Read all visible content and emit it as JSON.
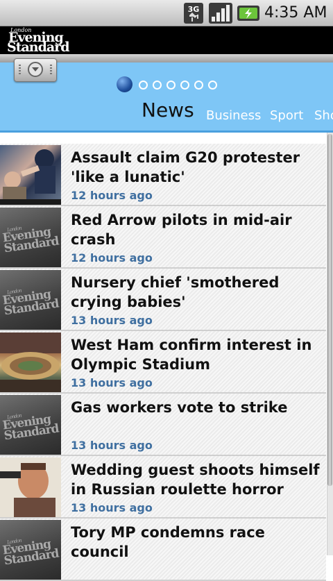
{
  "status_bar": {
    "network": "3G",
    "time": "4:35 AM",
    "icons": [
      "3g-data-icon",
      "signal-icon",
      "battery-charging-icon"
    ]
  },
  "brand": {
    "line1": "London",
    "line2": "Evening",
    "line3": "Standard"
  },
  "menu_button": {
    "icon": "chevron-down-icon"
  },
  "pager": {
    "count": 7,
    "active_index": 0
  },
  "tabs": {
    "active": "News",
    "others": [
      "Business",
      "Sport",
      "Sho"
    ]
  },
  "articles": [
    {
      "headline": "Assault claim G20 protester 'like a lunatic'",
      "time": "12 hours ago",
      "thumb": "photo-protest"
    },
    {
      "headline": "Red Arrow pilots in mid-air crash",
      "time": "12 hours ago",
      "thumb": "evening-standard-logo"
    },
    {
      "headline": "Nursery chief 'smothered crying babies'",
      "time": "13 hours ago",
      "thumb": "evening-standard-logo"
    },
    {
      "headline": "West Ham confirm interest in Olympic Stadium",
      "time": "13 hours ago",
      "thumb": "photo-stadium"
    },
    {
      "headline": "Gas workers vote to strike",
      "time": "13 hours ago",
      "thumb": "evening-standard-logo"
    },
    {
      "headline": "Wedding guest shoots himself in Russian roulette horror",
      "time": "13 hours ago",
      "thumb": "photo-man"
    },
    {
      "headline": "Tory MP condemns race council",
      "time": "",
      "thumb": "evening-standard-logo"
    }
  ],
  "colors": {
    "header_blue": "#7ec6f6",
    "time_text": "#3f6fa0",
    "brand_bar": "#000000"
  }
}
